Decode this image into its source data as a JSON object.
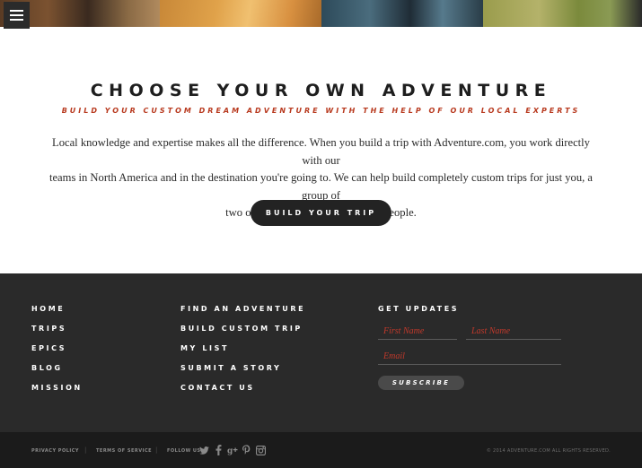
{
  "header": {
    "menu_icon": "hamburger-icon",
    "photos": [
      "boat-deck-photo",
      "sunset-water-photo",
      "kayak-water-photo",
      "grass-landscape-photo"
    ]
  },
  "main": {
    "heading": "CHOOSE YOUR OWN ADVENTURE",
    "subheading": "BUILD YOUR CUSTOM DREAM ADVENTURE WITH THE HELP OF OUR LOCAL EXPERTS",
    "body_line_1": "Local knowledge and expertise makes all the difference. When you build a trip with Adventure.com, you work directly with our",
    "body_line_2": "teams in North America and in the destination you're going to. We can help build completely custom trips for just you, a group of",
    "body_line_3": "two or even a group of 16 or more people.",
    "cta_label": "BUILD YOUR TRIP"
  },
  "footer": {
    "nav_col_1": [
      "HOME",
      "TRIPS",
      "EPICS",
      "BLOG",
      "MISSION"
    ],
    "nav_col_2": [
      "FIND AN ADVENTURE",
      "BUILD CUSTOM TRIP",
      "MY LIST",
      "SUBMIT A STORY",
      "CONTACT US"
    ],
    "updates": {
      "title": "GET UPDATES",
      "first_name_placeholder": "First Name",
      "last_name_placeholder": "Last Name",
      "email_placeholder": "Email",
      "subscribe_label": "SUBSCRIBE"
    }
  },
  "bottom_bar": {
    "privacy_policy": "PRIVACY POLICY",
    "separator": "|",
    "terms": "TERMS OF SERVICE",
    "follow_label": "FOLLOW US:",
    "social_icons": [
      "twitter-icon",
      "facebook-icon",
      "google-plus-icon",
      "pinterest-icon",
      "instagram-icon"
    ],
    "copyright": "© 2014 ADVENTURE.COM ALL RIGHTS RESERVED."
  },
  "colors": {
    "accent_red": "#b8391e",
    "footer_bg": "#2a2a2a",
    "bottom_bar_bg": "#1b1b1b",
    "button_dark": "#232323"
  }
}
